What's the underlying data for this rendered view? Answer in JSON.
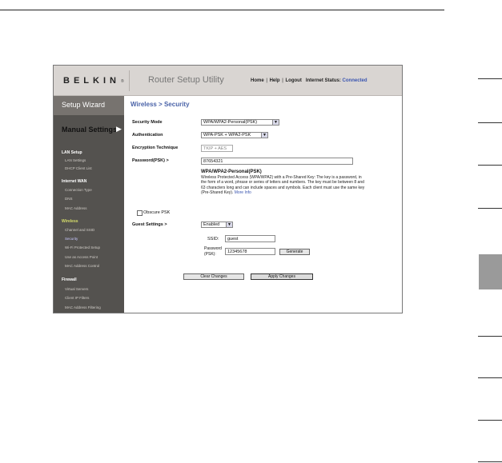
{
  "header": {
    "logo": "BELKIN",
    "logo_mark": "®",
    "app_title": "Router Setup Utility",
    "links": [
      "Home",
      "Help",
      "Logout"
    ],
    "status_label": "Internet Status:",
    "status_value": "Connected"
  },
  "sidebar": {
    "setup_wizard": "Setup Wizard",
    "manual_settings": "Manual Settings",
    "sections": [
      {
        "title": "LAN Setup",
        "items": [
          "LAN Settings",
          "DHCP Client List"
        ]
      },
      {
        "title": "Internet WAN",
        "items": [
          "Connection Type",
          "DNS",
          "MAC Address"
        ]
      },
      {
        "title": "Wireless",
        "items": [
          "Channel and SSID",
          "Security",
          "Wi-Fi Protected Setup",
          "Use as Access Point",
          "MAC Address Control"
        ]
      },
      {
        "title": "Firewall",
        "items": [
          "Virtual Servers",
          "Client IP Filters",
          "MAC Address Filtering"
        ]
      }
    ]
  },
  "main": {
    "breadcrumb": "Wireless > Security",
    "security_mode_label": "Security Mode",
    "security_mode_value": "WPA/WPA2-Personal(PSK)",
    "authentication_label": "Authentication",
    "authentication_value": "WPA-PSK + WPA2-PSK",
    "encryption_label": "Encryption Technique",
    "encryption_value": "TKIP + AES",
    "password_label": "Password(PSK) >",
    "password_value": "87654321",
    "desc_title": "WPA/WPA2-Personal(PSK)",
    "desc_text": "Wireless Protected Access (WPA/WPA2) with a Pre-Shared Key: The key is a password, in the form of a word, phrase or series of letters and numbers. The key must be between 8 and 63 characters long and can include spaces and symbols. Each client must use the same key (Pre-Shared Key).",
    "desc_more": "More Info",
    "obscure_psk_label": "Obscure PSK",
    "guest_label": "Guest Settings >",
    "guest_value": "Enabled",
    "ssid_label": "SSID:",
    "ssid_value": "guest",
    "guest_password_label_1": "Password",
    "guest_password_label_2": "(PSK):",
    "guest_password_value": "12345678",
    "generate_button": "Generate",
    "clear_button": "Clear Changes",
    "apply_button": "Apply Changes"
  }
}
